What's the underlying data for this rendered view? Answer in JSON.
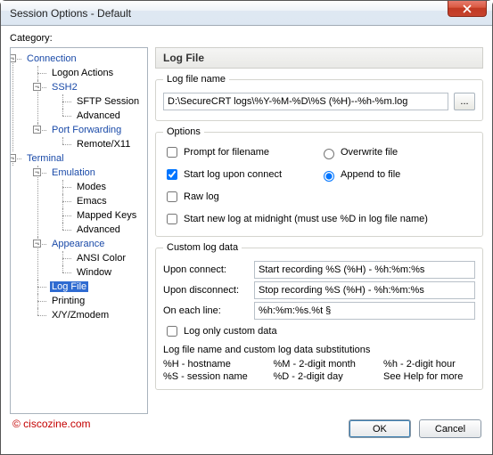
{
  "window": {
    "title": "Session Options - Default"
  },
  "category_label": "Category:",
  "tree": {
    "connection": "Connection",
    "logon": "Logon Actions",
    "ssh2": "SSH2",
    "sftp": "SFTP Session",
    "advanced1": "Advanced",
    "portfwd": "Port Forwarding",
    "remotex11": "Remote/X11",
    "terminal": "Terminal",
    "emulation": "Emulation",
    "modes": "Modes",
    "emacs": "Emacs",
    "mapped": "Mapped Keys",
    "advanced2": "Advanced",
    "appearance": "Appearance",
    "ansi": "ANSI Color",
    "window": "Window",
    "logfile": "Log File",
    "printing": "Printing",
    "xyz": "X/Y/Zmodem"
  },
  "panel_title": "Log File",
  "logfile": {
    "group_label": "Log file name",
    "value": "D:\\SecureCRT logs\\%Y-%M-%D\\%S (%H)--%h-%m.log",
    "browse": "..."
  },
  "options": {
    "group_label": "Options",
    "prompt": "Prompt for filename",
    "start_on_connect": "Start log upon connect",
    "raw": "Raw log",
    "new_at_midnight": "Start new log at midnight (must use %D in log file name)",
    "overwrite": "Overwrite file",
    "append": "Append to file"
  },
  "custom": {
    "group_label": "Custom log data",
    "upon_connect_lbl": "Upon connect:",
    "upon_connect_val": "Start recording %S (%H) - %h:%m:%s",
    "upon_disconnect_lbl": "Upon disconnect:",
    "upon_disconnect_val": "Stop recording %S (%H) - %h:%m:%s",
    "each_line_lbl": "On each line:",
    "each_line_val": "%h:%m:%s.%t §",
    "log_only_custom": "Log only custom data"
  },
  "subs": {
    "head": "Log file name and custom log data substitutions",
    "h_host": "%H - hostname",
    "m_month": "%M - 2-digit month",
    "h_hour": "%h  -  2-digit hour",
    "s_session": "%S - session name",
    "d_day": "%D - 2-digit day",
    "see_help": "See Help for more"
  },
  "buttons": {
    "ok": "OK",
    "cancel": "Cancel"
  },
  "watermark": "© ciscozine.com"
}
